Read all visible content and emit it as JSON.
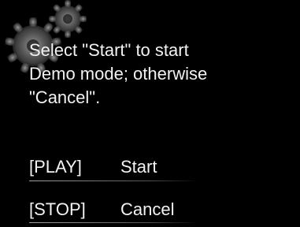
{
  "dialog": {
    "message_lines": [
      "Select \"Start\" to start",
      "Demo mode; otherwise",
      "\"Cancel\"."
    ],
    "options": [
      {
        "key": "[PLAY]",
        "label": "Start"
      },
      {
        "key": "[STOP]",
        "label": "Cancel"
      }
    ]
  },
  "colors": {
    "background": "#000000",
    "text": "#f2f2f2",
    "gear": "#8a8a8a"
  },
  "icons": {
    "background_decoration": "gears-icon"
  }
}
